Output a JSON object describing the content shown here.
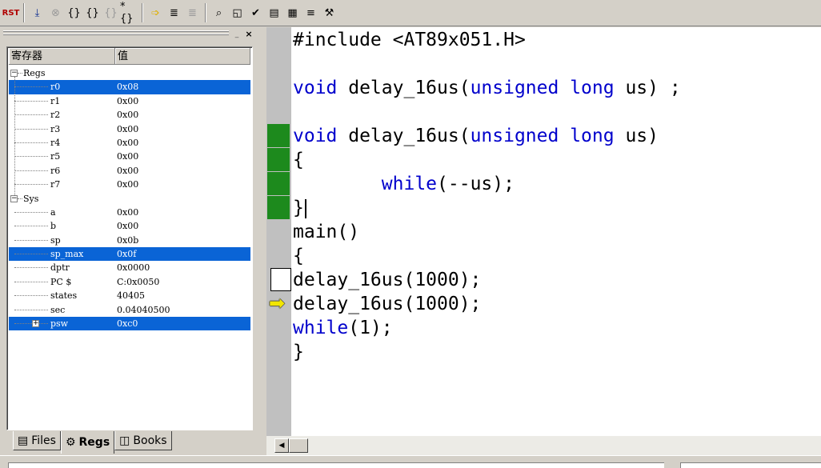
{
  "toolbar": {
    "buttons": [
      {
        "icon": "reset-cpu-icon",
        "label": "RST"
      },
      {
        "icon": "run-icon",
        "glyph": "⤓"
      },
      {
        "icon": "stop-icon",
        "glyph": "⊗"
      },
      {
        "icon": "step-into-icon",
        "glyph": "{}"
      },
      {
        "icon": "step-over-icon",
        "glyph": "{}"
      },
      {
        "icon": "step-out-icon",
        "glyph": "{}"
      },
      {
        "icon": "run-to-cursor-icon",
        "glyph": "*{}"
      },
      {
        "icon": "show-next-statement-icon",
        "glyph": "➩"
      },
      {
        "icon": "enable-trace-icon",
        "glyph": "≣"
      },
      {
        "icon": "view-trace-icon",
        "glyph": "≣"
      },
      {
        "icon": "disassembly-window-icon",
        "glyph": "⌕"
      },
      {
        "icon": "watch-window-icon",
        "glyph": "◱"
      },
      {
        "icon": "code-coverage-icon",
        "glyph": "✔"
      },
      {
        "icon": "performance-analyzer-icon",
        "glyph": "▤"
      },
      {
        "icon": "logic-analyzer-icon",
        "glyph": "▦"
      },
      {
        "icon": "symbols-window-icon",
        "glyph": "≡"
      },
      {
        "icon": "toolbox-icon",
        "glyph": "⚒"
      }
    ]
  },
  "panel": {
    "minimize_glyph": "_",
    "close_glyph": "×",
    "columns": [
      "寄存器",
      "值"
    ],
    "groups": [
      {
        "name": "Regs",
        "expander": "−",
        "rows": [
          {
            "name": "r0",
            "value": "0x08",
            "selected": true
          },
          {
            "name": "r1",
            "value": "0x00"
          },
          {
            "name": "r2",
            "value": "0x00"
          },
          {
            "name": "r3",
            "value": "0x00"
          },
          {
            "name": "r4",
            "value": "0x00"
          },
          {
            "name": "r5",
            "value": "0x00"
          },
          {
            "name": "r6",
            "value": "0x00"
          },
          {
            "name": "r7",
            "value": "0x00"
          }
        ]
      },
      {
        "name": "Sys",
        "expander": "−",
        "rows": [
          {
            "name": "a",
            "value": "0x00"
          },
          {
            "name": "b",
            "value": "0x00"
          },
          {
            "name": "sp",
            "value": "0x0b"
          },
          {
            "name": "sp_max",
            "value": "0x0f",
            "selected": true
          },
          {
            "name": "dptr",
            "value": "0x0000"
          },
          {
            "name": "PC  $",
            "value": "C:0x0050"
          },
          {
            "name": "states",
            "value": "40405"
          },
          {
            "name": "sec",
            "value": "0.04040500"
          },
          {
            "name": "psw",
            "value": "0xc0",
            "selected": true,
            "expander": "+"
          }
        ]
      }
    ],
    "tabs": [
      {
        "label": "Files",
        "icon": "files-tab-icon",
        "glyph": "▤",
        "active": false
      },
      {
        "label": "Regs",
        "icon": "regs-tab-icon",
        "glyph": "⚙",
        "active": true
      },
      {
        "label": "Books",
        "icon": "books-tab-icon",
        "glyph": "◫",
        "active": false
      }
    ]
  },
  "editor": {
    "lines": [
      {
        "text": "#include <AT89x051.H>"
      },
      {
        "text": ""
      },
      {
        "text": "void delay_16us(unsigned long us) ;"
      },
      {
        "text": ""
      },
      {
        "text": "void delay_16us(unsigned long us)",
        "mark": "green"
      },
      {
        "text": "{",
        "mark": "green"
      },
      {
        "text": "        while(--us);",
        "mark": "green"
      },
      {
        "text": "}",
        "mark": "green",
        "cursor": true
      },
      {
        "text": "main()"
      },
      {
        "text": "{"
      },
      {
        "text": "delay_16us(1000);",
        "mark": "white"
      },
      {
        "text": "delay_16us(1000);",
        "mark": "arrow"
      },
      {
        "text": "while(1);"
      },
      {
        "text": "}"
      }
    ],
    "keywords": [
      "void",
      "unsigned",
      "long",
      "while"
    ],
    "colors": {
      "keyword": "#0000cc",
      "executed_marker": "#1d8a1d",
      "current_line_arrow": "#f2e600",
      "selection": "#0a64d6"
    }
  },
  "scrollbar": {
    "left_arrow": "◀"
  }
}
